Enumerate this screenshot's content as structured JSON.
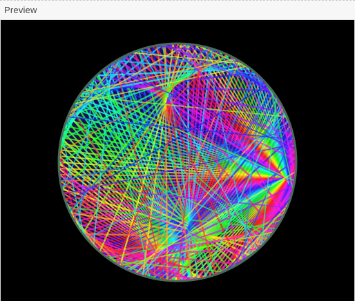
{
  "panel": {
    "title": "Preview"
  },
  "preview": {
    "background": "#000000",
    "rim_color": "#4a6a5a",
    "art": "string-art-circle"
  },
  "colors": {
    "header_bg": "#f7f7f7",
    "title_text": "#444444"
  }
}
